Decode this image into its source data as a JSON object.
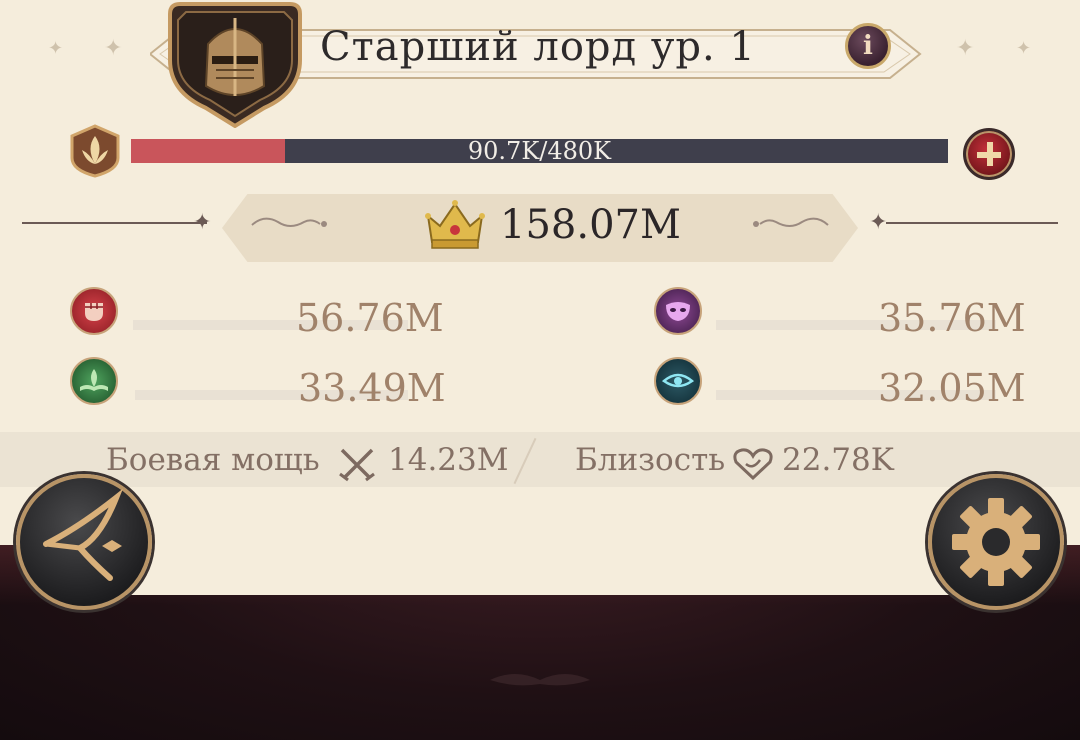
{
  "header": {
    "title": "Старший лорд ур. 1",
    "info_icon": "info-icon"
  },
  "level_bar": {
    "text": "90.7K/480K",
    "progress": 0.189,
    "fill_color": "#c9555b",
    "track_color": "#3f3f4c"
  },
  "power": {
    "value": "158.07M"
  },
  "stats": [
    {
      "icon": "fist-icon",
      "value": "56.76M",
      "color": "#c8343c"
    },
    {
      "icon": "mask-icon",
      "value": "35.76M",
      "color": "#d987e0"
    },
    {
      "icon": "book-icon",
      "value": "33.49M",
      "color": "#5ab06a"
    },
    {
      "icon": "eye-icon",
      "value": "32.05M",
      "color": "#6fd0e0"
    }
  ],
  "summary": {
    "combat_label": "Боевая мощь",
    "combat_value": "14.23M",
    "affinity_label": "Близость",
    "affinity_value": "22.78K"
  },
  "buttons": {
    "left_icon": "quill-icon",
    "right_icon": "gear-icon"
  }
}
